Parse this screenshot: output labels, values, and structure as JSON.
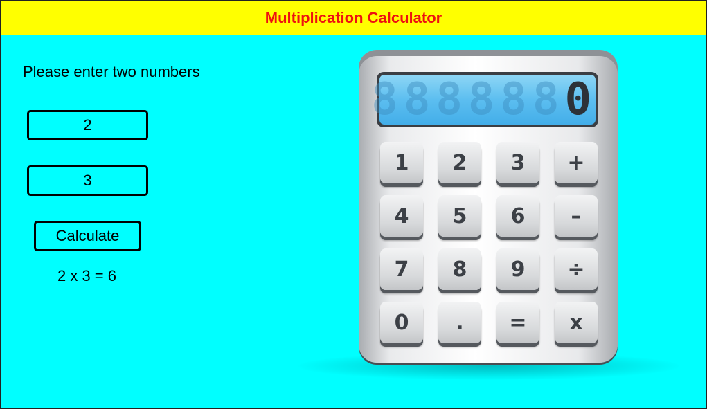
{
  "window": {
    "title": "Multiplication Calculator"
  },
  "form": {
    "prompt": "Please enter two numbers",
    "first_number": "2",
    "second_number": "3",
    "calculate_label": "Calculate",
    "result_text": "2 x 3 = 6"
  },
  "calculator_image": {
    "display_value": "0",
    "unlit_digits": [
      "8",
      "8",
      "8",
      "8",
      "8",
      "8"
    ],
    "keys": [
      {
        "label": "1"
      },
      {
        "label": "2"
      },
      {
        "label": "3"
      },
      {
        "label": "+"
      },
      {
        "label": "4"
      },
      {
        "label": "5"
      },
      {
        "label": "6"
      },
      {
        "label": "–"
      },
      {
        "label": "7"
      },
      {
        "label": "8"
      },
      {
        "label": "9"
      },
      {
        "label": "÷"
      },
      {
        "label": "0"
      },
      {
        "label": "."
      },
      {
        "label": "="
      },
      {
        "label": "x"
      }
    ]
  },
  "colors": {
    "background": "#00ffff",
    "title_bar": "#ffff00",
    "title_text": "#ee1111"
  }
}
